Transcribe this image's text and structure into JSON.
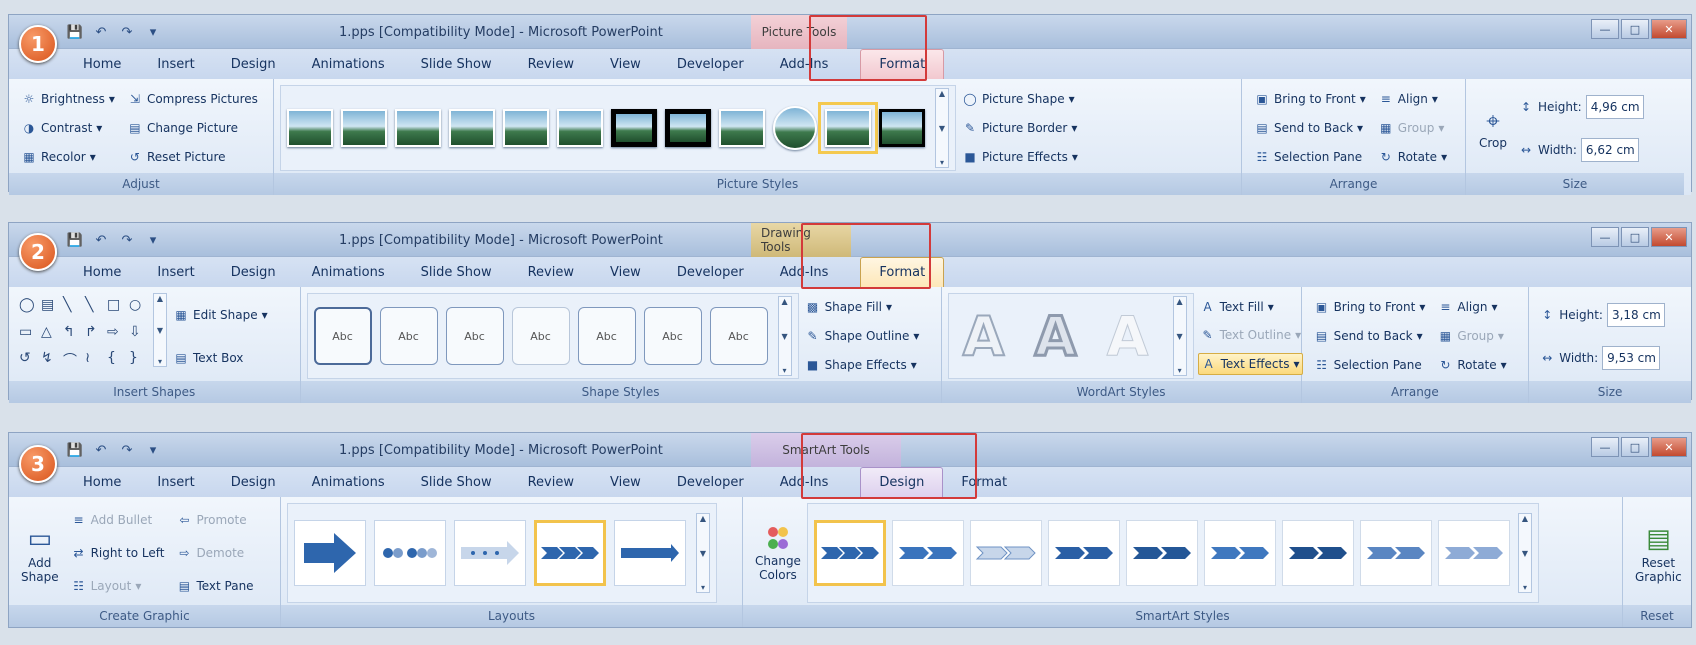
{
  "ribbons": [
    {
      "badge": "1",
      "title": "1.pps [Compatibility Mode] - Microsoft PowerPoint",
      "context_tools": "Picture Tools",
      "tabs": [
        "Home",
        "Insert",
        "Design",
        "Animations",
        "Slide Show",
        "Review",
        "View",
        "Developer",
        "Add-Ins"
      ],
      "context_tabs": [
        "Format"
      ],
      "adjust": {
        "label": "Adjust",
        "brightness": "Brightness",
        "contrast": "Contrast",
        "recolor": "Recolor",
        "compress": "Compress Pictures",
        "change": "Change Picture",
        "reset": "Reset Picture"
      },
      "picture_styles": {
        "label": "Picture Styles",
        "shape": "Picture Shape",
        "border": "Picture Border",
        "effects": "Picture Effects"
      },
      "arrange": {
        "label": "Arrange",
        "front": "Bring to Front",
        "back": "Send to Back",
        "pane": "Selection Pane",
        "align": "Align",
        "group": "Group",
        "rotate": "Rotate"
      },
      "size": {
        "label": "Size",
        "crop": "Crop",
        "height_label": "Height:",
        "height": "4,96 cm",
        "width_label": "Width:",
        "width": "6,62 cm"
      }
    },
    {
      "badge": "2",
      "title": "1.pps [Compatibility Mode] - Microsoft PowerPoint",
      "context_tools": "Drawing Tools",
      "tabs": [
        "Home",
        "Insert",
        "Design",
        "Animations",
        "Slide Show",
        "Review",
        "View",
        "Developer",
        "Add-Ins"
      ],
      "context_tabs": [
        "Format"
      ],
      "insert_shapes": {
        "label": "Insert Shapes",
        "edit_shape": "Edit Shape",
        "text_box": "Text Box"
      },
      "shape_styles": {
        "label": "Shape Styles",
        "thumb": "Abc",
        "fill": "Shape Fill",
        "outline": "Shape Outline",
        "effects": "Shape Effects"
      },
      "wordart": {
        "label": "WordArt Styles",
        "glyph": "A",
        "fill": "Text Fill",
        "outline": "Text Outline",
        "effects": "Text Effects"
      },
      "arrange": {
        "label": "Arrange",
        "front": "Bring to Front",
        "back": "Send to Back",
        "pane": "Selection Pane",
        "align": "Align",
        "group": "Group",
        "rotate": "Rotate"
      },
      "size": {
        "label": "Size",
        "height_label": "Height:",
        "height": "3,18 cm",
        "width_label": "Width:",
        "width": "9,53 cm"
      }
    },
    {
      "badge": "3",
      "title": "1.pps [Compatibility Mode] - Microsoft PowerPoint",
      "context_tools": "SmartArt Tools",
      "tabs": [
        "Home",
        "Insert",
        "Design",
        "Animations",
        "Slide Show",
        "Review",
        "View",
        "Developer",
        "Add-Ins"
      ],
      "context_tabs": [
        "Design",
        "Format"
      ],
      "create_graphic": {
        "label": "Create Graphic",
        "add_shape_1": "Add",
        "add_shape_2": "Shape",
        "add_bullet": "Add Bullet",
        "rtl": "Right to Left",
        "layout": "Layout",
        "promote": "Promote",
        "demote": "Demote",
        "text_pane": "Text Pane"
      },
      "layouts": {
        "label": "Layouts"
      },
      "smartart_styles": {
        "label": "SmartArt Styles",
        "change_1": "Change",
        "change_2": "Colors"
      },
      "reset": {
        "label": "Reset",
        "btn_1": "Reset",
        "btn_2": "Graphic"
      }
    }
  ],
  "colors": {
    "accent_red": "#d33a3a",
    "badge_orange": "#d9541c",
    "selection_gold": "#f2c34c"
  }
}
